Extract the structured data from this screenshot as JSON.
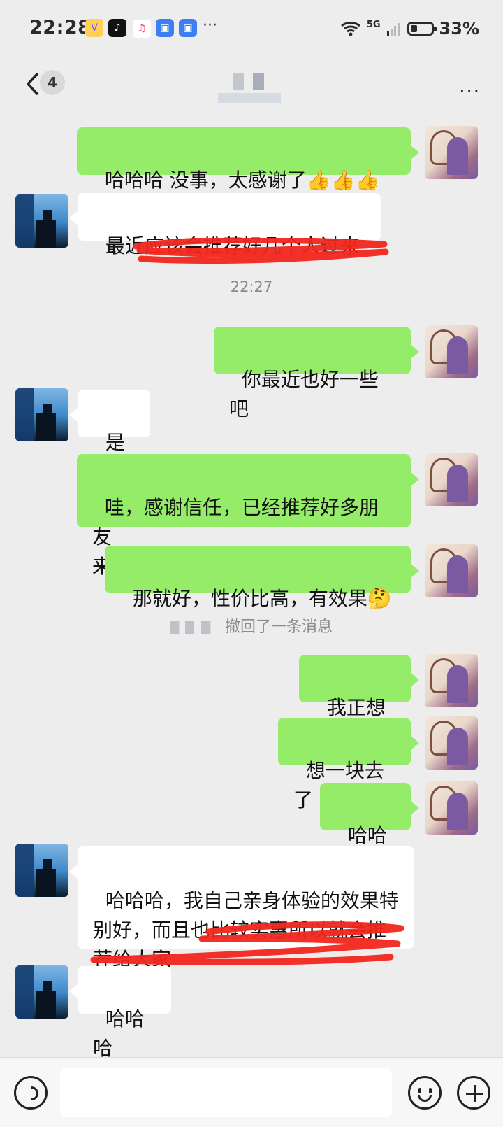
{
  "status": {
    "time": "22:28",
    "network": "5G",
    "battery": "33%",
    "more": "···"
  },
  "nav": {
    "unread_count": "4",
    "title": "",
    "more": "···"
  },
  "messages": [
    {
      "sender": "me",
      "text": "哈哈哈 没事，太感谢了",
      "emoji": "👍👍👍"
    },
    {
      "sender": "them",
      "text": "最近应该会推荐好几个人过来"
    },
    {
      "time": "22:27"
    },
    {
      "sender": "me",
      "text": "你最近也好一些吧"
    },
    {
      "sender": "them",
      "text": "是的"
    },
    {
      "sender": "me",
      "text": "哇，感谢信任，已经推荐好多朋友\n来了",
      "emoji": "😁"
    },
    {
      "sender": "me",
      "text": "那就好，性价比高，有效果",
      "emoji": "🤔"
    },
    {
      "system": "撤回了一条消息"
    },
    {
      "sender": "me",
      "text": "我正想说"
    },
    {
      "sender": "me",
      "text": "想一块去了"
    },
    {
      "sender": "me",
      "text": "哈哈哈"
    },
    {
      "sender": "them",
      "text": "哈哈哈，我自己亲身体验的效果特\n别好，而且也比较实惠所以就会推\n荐给大家"
    },
    {
      "sender": "them",
      "text": "哈哈哈"
    }
  ],
  "colors": {
    "sent_bubble": "#95ec69",
    "received_bubble": "#ffffff",
    "background": "#ededed",
    "annotation": "#f1261d"
  }
}
